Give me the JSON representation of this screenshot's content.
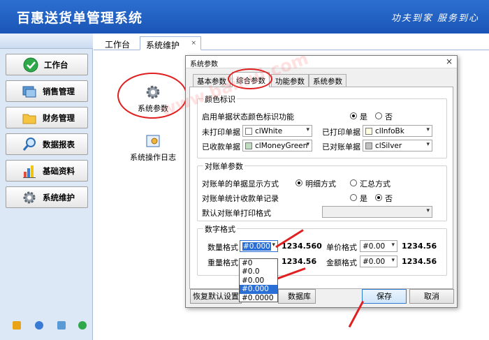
{
  "app": {
    "title": "百惠送货单管理系统",
    "slogan": "功夫到家 服务到心"
  },
  "sidebar": {
    "items": [
      {
        "label": "工作台",
        "icon": "check-icon"
      },
      {
        "label": "销售管理",
        "icon": "window-icon"
      },
      {
        "label": "财务管理",
        "icon": "folder-icon"
      },
      {
        "label": "数据报表",
        "icon": "magnifier-icon"
      },
      {
        "label": "基础资料",
        "icon": "chart-icon"
      },
      {
        "label": "系统维护",
        "icon": "gear-icon"
      }
    ]
  },
  "tabs": [
    {
      "label": "工作台"
    },
    {
      "label": "系统维护",
      "close": "×"
    }
  ],
  "desktop": {
    "sys_params": "系统参数",
    "op_log": "系统操作日志"
  },
  "dialog": {
    "title": "系统参数",
    "close": "×",
    "tabs": [
      "基本参数",
      "综合参数",
      "功能参数",
      "系统参数"
    ],
    "color_section": {
      "legend": "颜色标识",
      "enable_label": "启用单据状态颜色标识功能",
      "yes": "是",
      "no": "否",
      "unprinted_label": "未打印单据",
      "unprinted_value": "clWhite",
      "printed_label": "已打印单据",
      "printed_value": "clInfoBk",
      "received_label": "已收款单据",
      "received_value": "clMoneyGreen",
      "reconciled_label": "已对账单据",
      "reconciled_value": "clSilver"
    },
    "recon_section": {
      "legend": "对账单参数",
      "display_label": "对账单的单据显示方式",
      "detail": "明细方式",
      "summary": "汇总方式",
      "stat_label": "对账单统计收款单记录",
      "yes": "是",
      "no": "否",
      "print_label": "默认对账单打印格式"
    },
    "num_section": {
      "legend": "数字格式",
      "qty_label": "数量格式",
      "qty_value": "#0.000",
      "qty_preview": "1234.560",
      "weight_label": "重量格式",
      "weight_preview": "1234.56",
      "price_label": "单价格式",
      "price_value": "#0.00",
      "price_preview": "1234.56",
      "amount_label": "金额格式",
      "amount_value": "#0.00",
      "amount_preview": "1234.56"
    },
    "dropdown_options": [
      "#0",
      "#0.0",
      "#0.00",
      "#0.000",
      "#0.0000"
    ],
    "buttons": {
      "restore": "恢复默认设置",
      "database": "数据库",
      "save": "保存",
      "cancel": "取消"
    }
  },
  "watermark": "www.baihui.com",
  "colors": {
    "header": "#1a55b5",
    "annotation": "#e02020",
    "selection": "#2a6fd6"
  }
}
